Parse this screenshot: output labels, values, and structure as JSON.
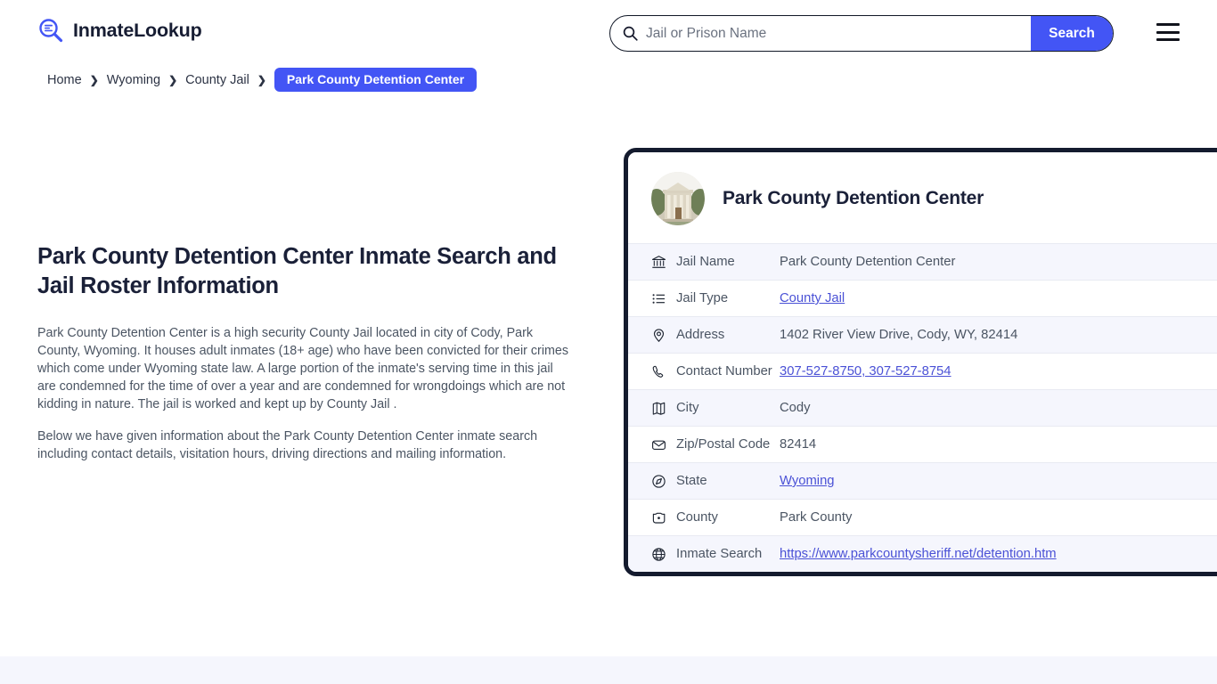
{
  "header": {
    "brand_name": "InmateLookup",
    "brand_icon": "magnifier-list-logo-icon",
    "menu_icon": "hamburger-menu-icon"
  },
  "search": {
    "icon": "search-icon",
    "placeholder": "Jail or Prison Name",
    "value": "",
    "button_label": "Search"
  },
  "breadcrumb": {
    "items": [
      {
        "label": "Home",
        "current": false
      },
      {
        "label": "Wyoming",
        "current": false
      },
      {
        "label": "County Jail",
        "current": false
      },
      {
        "label": "Park County Detention Center",
        "current": true
      }
    ],
    "separator": "❯"
  },
  "main": {
    "page_title": "Park County Detention Center Inmate Search and Jail Roster Information",
    "paragraph_1": "Park County Detention Center is a high security County Jail located in city of Cody, Park County, Wyoming. It houses adult inmates (18+ age) who have been convicted for their crimes which come under Wyoming state law. A large portion of the inmate's serving time in this jail are condemned for the time of over a year and are condemned for wrongdoings which are not kidding in nature. The jail is worked and kept up by County Jail .",
    "paragraph_2": "Below we have given information about the Park County Detention Center inmate search including contact details, visitation hours, driving directions and mailing information."
  },
  "card": {
    "photo_icon": "courthouse-building-photo",
    "title": "Park County Detention Center",
    "rows": [
      {
        "icon": "bank-building-icon",
        "label": "Jail Name",
        "value": "Park County Detention Center",
        "link": false
      },
      {
        "icon": "list-icon",
        "label": "Jail Type",
        "value": "County Jail",
        "link": true
      },
      {
        "icon": "map-pin-icon",
        "label": "Address",
        "value": "1402 River View Drive, Cody, WY, 82414",
        "link": false
      },
      {
        "icon": "phone-icon",
        "label": "Contact Number",
        "value": "307-527-8750, 307-527-8754",
        "link": true
      },
      {
        "icon": "map-icon",
        "label": "City",
        "value": "Cody",
        "link": false
      },
      {
        "icon": "envelope-icon",
        "label": "Zip/Postal Code",
        "value": "82414",
        "link": false
      },
      {
        "icon": "globe-compass-icon",
        "label": "State",
        "value": "Wyoming",
        "link": true
      },
      {
        "icon": "county-shield-icon",
        "label": "County",
        "value": "Park County",
        "link": false
      },
      {
        "icon": "globe-icon",
        "label": "Inmate Search",
        "value": "https://www.parkcountysheriff.net/detention.htm",
        "link": true
      }
    ]
  },
  "colors": {
    "accent": "#4355f5",
    "link": "#4a51d6",
    "card_border": "#141b2e",
    "heading": "#1a2038",
    "row_alt_bg": "#f5f6fd",
    "band_bg": "#f5f6fd"
  }
}
